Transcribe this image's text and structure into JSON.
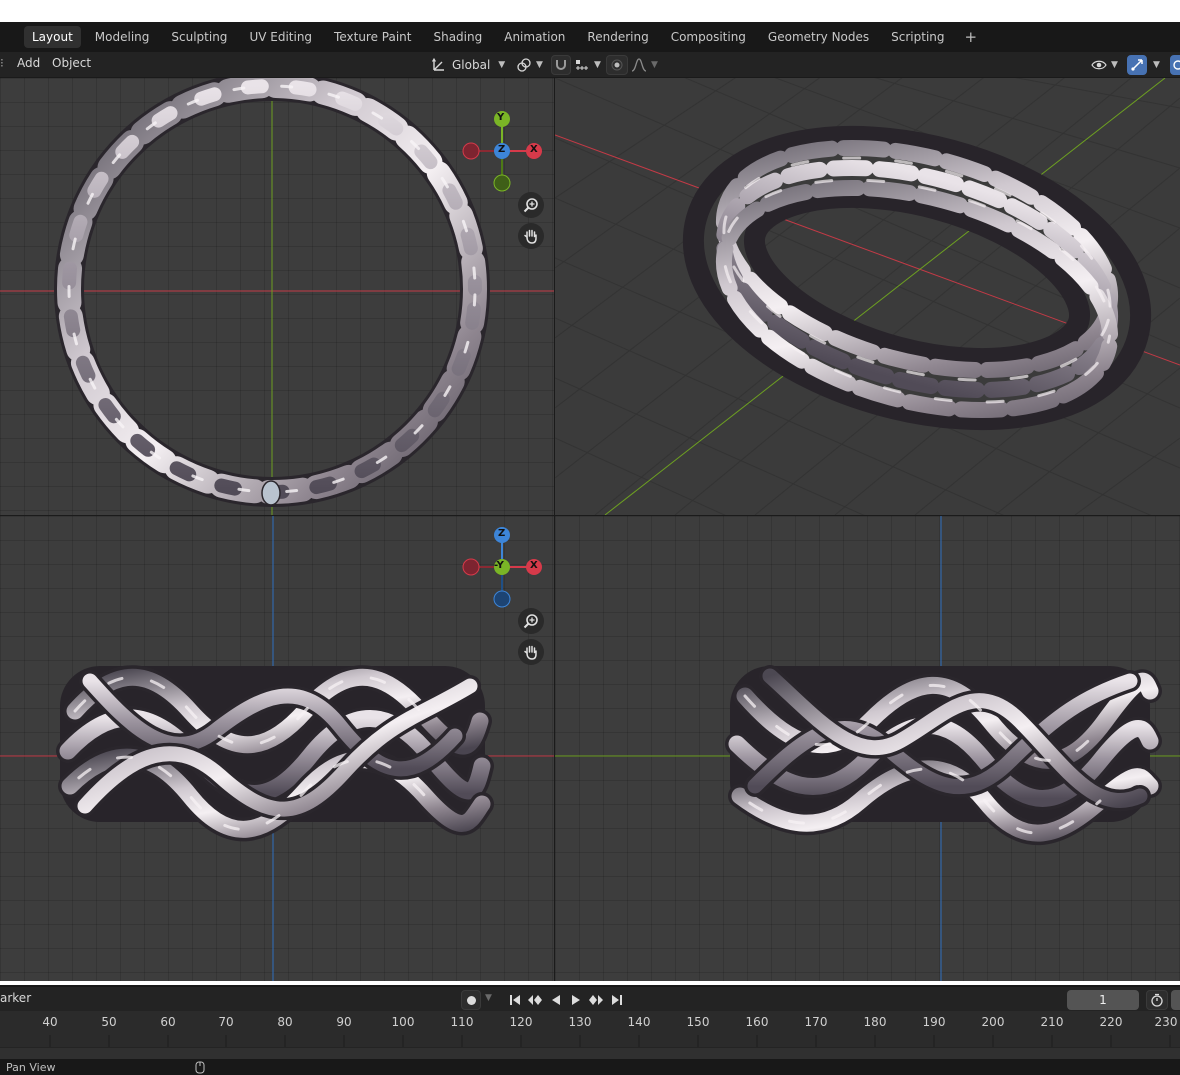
{
  "workspace_tabs": [
    {
      "label": "Layout",
      "active": true
    },
    {
      "label": "Modeling",
      "active": false
    },
    {
      "label": "Sculpting",
      "active": false
    },
    {
      "label": "UV Editing",
      "active": false
    },
    {
      "label": "Texture Paint",
      "active": false
    },
    {
      "label": "Shading",
      "active": false
    },
    {
      "label": "Animation",
      "active": false
    },
    {
      "label": "Rendering",
      "active": false
    },
    {
      "label": "Compositing",
      "active": false
    },
    {
      "label": "Geometry Nodes",
      "active": false
    },
    {
      "label": "Scripting",
      "active": false
    }
  ],
  "add_workspace_label": "+",
  "header": {
    "menu": [
      "Add",
      "Object"
    ],
    "transform_orientation": "Global",
    "icons": {
      "orientation": "transform-orientation-icon",
      "pivot": "pivot-point-icon",
      "snap": "snap-magnet-icon",
      "snap_target": "snap-increment-icon",
      "proportional": "proportional-editing-icon",
      "falloff": "falloff-curve-icon",
      "visibility": "visibility-eye-icon",
      "gizmo": "gizmo-toggle-icon"
    }
  },
  "gizmo_top": {
    "y": "Y",
    "z": "Z",
    "x": "X"
  },
  "gizmo_front": {
    "z": "Z",
    "neg_y": "-Y",
    "x": "X"
  },
  "colors": {
    "accent": "#4772b3",
    "axis_x": "#d63a4a",
    "axis_y": "#7ab526",
    "axis_z": "#3d85d8",
    "viewport_bg": "#3d3d3d",
    "metal_light": "#e6e0e4",
    "metal_dark": "#5a5560"
  },
  "timeline": {
    "marker_label": "arker",
    "current_frame": "1",
    "ticks": [
      "40",
      "50",
      "60",
      "70",
      "80",
      "90",
      "100",
      "110",
      "120",
      "130",
      "140",
      "150",
      "160",
      "170",
      "180",
      "190",
      "200",
      "210",
      "220",
      "230"
    ],
    "playback_icons": [
      "jump-start-icon",
      "prev-keyframe-icon",
      "play-reverse-icon",
      "play-icon",
      "next-keyframe-icon",
      "jump-end-icon"
    ]
  },
  "status_bar": {
    "left": "Pan View"
  }
}
